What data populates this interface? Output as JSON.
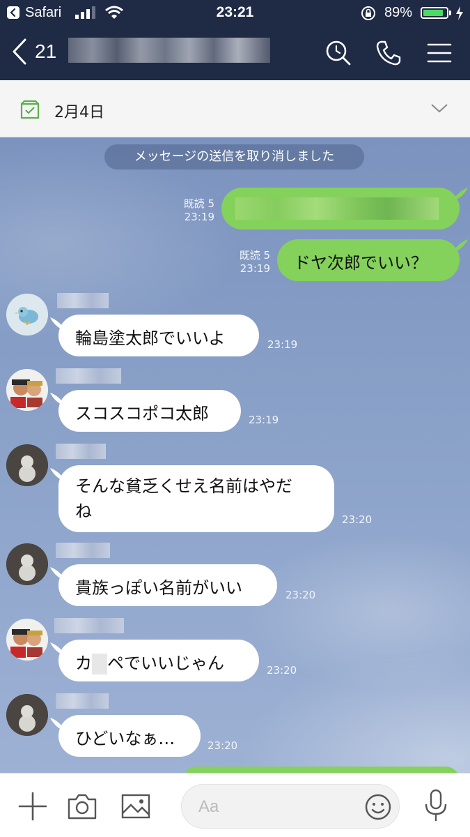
{
  "status_bar": {
    "app_label": "Safari",
    "time": "23:21",
    "battery_percent_text": "89%",
    "battery_level": 0.89
  },
  "nav": {
    "member_count": "21"
  },
  "date_header": {
    "date": "2月4日"
  },
  "chat": {
    "system_notice": "メッセージの送信を取り消しました",
    "messages": [
      {
        "side": "out",
        "read_label": "既読 5",
        "time": "23:19",
        "text": ""
      },
      {
        "side": "out",
        "read_label": "既読 5",
        "time": "23:19",
        "text": "ドヤ次郎でいい？"
      },
      {
        "side": "in",
        "time": "23:19",
        "text": "輪島塗太郎でいいよ"
      },
      {
        "side": "in",
        "time": "23:19",
        "text": "スコスコポコ太郎"
      },
      {
        "side": "in",
        "time": "23:20",
        "text_line1": "そんな貧乏くせえ名前はやだ",
        "text_line2": "ね"
      },
      {
        "side": "in",
        "time": "23:20",
        "text": "貴族っぽい名前がいい"
      },
      {
        "side": "in",
        "time": "23:20",
        "text_before": "カ",
        "text_after": "ペでいいじゃん"
      },
      {
        "side": "in",
        "time": "23:20",
        "text": "ひどいなぁ…"
      }
    ]
  },
  "input_bar": {
    "placeholder": "Aa"
  },
  "colors": {
    "header_bg": "#1f2a44",
    "outgoing_bubble": "#84d25b",
    "incoming_bubble": "#ffffff",
    "battery_fill": "#4cd964",
    "calendar_icon": "#5ab04a"
  },
  "icons": [
    "back-app-icon",
    "signal-icon",
    "wifi-icon",
    "rotation-lock-icon",
    "battery-icon",
    "charging-icon",
    "back-chevron-icon",
    "search-icon",
    "phone-icon",
    "menu-icon",
    "calendar-check-icon",
    "chevron-down-icon",
    "plus-icon",
    "camera-icon",
    "image-icon",
    "emoji-icon",
    "microphone-icon"
  ]
}
